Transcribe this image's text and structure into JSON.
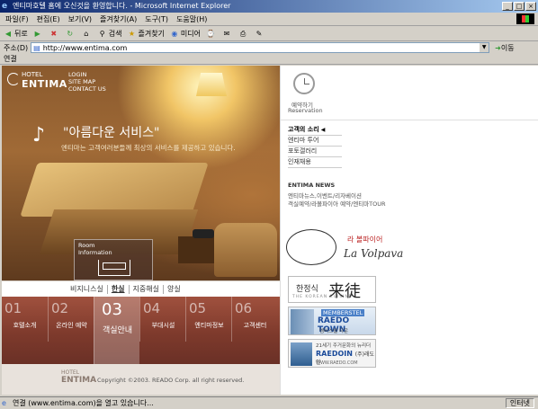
{
  "window": {
    "title": "엔티마호텔 홈에 오신것을 환영합니다. - Microsoft Internet Explorer",
    "buttons": [
      "_",
      "□",
      "×"
    ]
  },
  "menubar": [
    "파일(F)",
    "편집(E)",
    "보기(V)",
    "즐겨찾기(A)",
    "도구(T)",
    "도움말(H)"
  ],
  "toolbar": {
    "back": "뒤로",
    "search": "검색",
    "favorites": "즐겨찾기",
    "media": "미디어"
  },
  "address": {
    "label": "주소(D)",
    "url": "http://www.entima.com",
    "go": "이동"
  },
  "links_label": "연결",
  "site": {
    "logo_small": "HOTEL",
    "logo_main": "ENTIMA",
    "top_links": [
      "LOGIN",
      "SITE MAP",
      "CONTACT US"
    ],
    "tagline": "\"아름다운 서비스\"",
    "tagline_sub": "엔티마는 고객여러분들께 최상의 서비스를 제공하고 있습니다.",
    "room_info": [
      "Room",
      "Information"
    ],
    "languages": [
      {
        "label": "비지니스실",
        "active": false
      },
      {
        "label": "한실",
        "active": true
      },
      {
        "label": "지중해실",
        "active": false
      },
      {
        "label": "양실",
        "active": false
      }
    ],
    "main_menu": [
      {
        "num": "01",
        "label": "호텔소개"
      },
      {
        "num": "02",
        "label": "온라인 예약"
      },
      {
        "num": "03",
        "label": "객실안내"
      },
      {
        "num": "04",
        "label": "부대시설"
      },
      {
        "num": "05",
        "label": "엔티마정보"
      },
      {
        "num": "06",
        "label": "고객센터"
      }
    ],
    "active_menu": "03",
    "footer_logo": [
      "HOTEL",
      "ENTIMA"
    ],
    "copyright": "Copyright ©2003. READO Corp. all right reserved."
  },
  "right": {
    "reservation_ko": "예약하기",
    "reservation_en": "Reservation",
    "side_menu": [
      "고객의 소리",
      "엔티마 투어",
      "포토갤러리",
      "인재채용"
    ],
    "news_title": "ENTIMA NEWS",
    "news": [
      "엔티마뉴스,이벤트/리자베이션",
      "객실예약/라볼파이아 예약/엔티마TOUR"
    ],
    "volpava_ko": "라 볼파이어",
    "volpava_en": "La Volpava",
    "banner1": {
      "ko": "한정식",
      "han": "来徒",
      "sub": "THE KOREAN CUISINE"
    },
    "banner2": {
      "line1": "MEMBERSTEL",
      "line2": "RAEDO TOWN",
      "line3": "멤버스텔 타운"
    },
    "banner3": {
      "line1": "21세기 주거문화의 뉴리더",
      "line2": "RAEDOIN",
      "line2b": "(주)래도인",
      "line3": "WWW.RAEDO.COM"
    }
  },
  "status": {
    "text": "연결 (www.entima.com)을 열고 있습니다...",
    "zone": "인터넷"
  },
  "colors": {
    "titlebar": "#0a246a",
    "menu_strip": "#7e3a2c",
    "accent_news": "#1a4a9a"
  }
}
